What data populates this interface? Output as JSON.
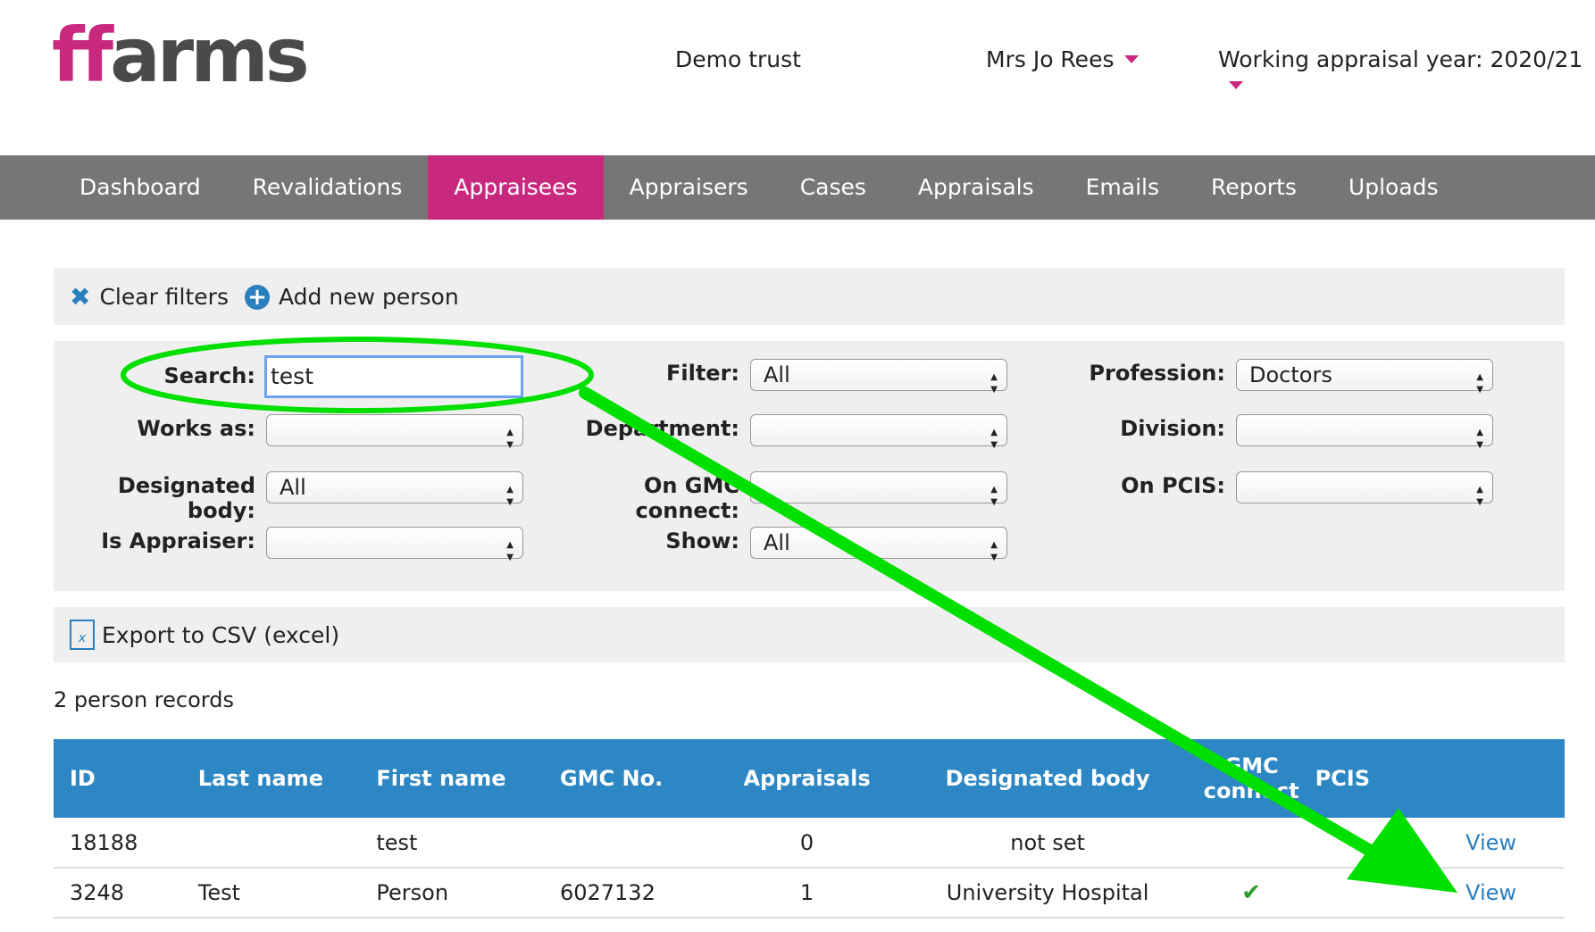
{
  "header": {
    "logo_ff": "ff",
    "logo_rest": "arms",
    "organisation": "Demo trust",
    "user": "Mrs Jo Rees",
    "appraisal_year": "Working appraisal year: 2020/21"
  },
  "nav": {
    "items": [
      "Dashboard",
      "Revalidations",
      "Appraisees",
      "Appraisers",
      "Cases",
      "Appraisals",
      "Emails",
      "Reports",
      "Uploads"
    ],
    "active": "Appraisees"
  },
  "actions": {
    "clear_filters": "Clear filters",
    "add_person": "Add new person",
    "export": "Export to CSV (excel)"
  },
  "filters": {
    "search_label": "Search:",
    "search_value": "test",
    "filter_label": "Filter:",
    "filter_value": "All",
    "profession_label": "Profession:",
    "profession_value": "Doctors",
    "works_as_label": "Works as:",
    "works_as_value": "",
    "department_label": "Department:",
    "department_value": "",
    "division_label": "Division:",
    "division_value": "",
    "designated_body_label": "Designated body:",
    "designated_body_value": "All",
    "gmc_connect_label": "On GMC connect:",
    "gmc_connect_value": "",
    "pcis_label": "On PCIS:",
    "pcis_value": "",
    "is_appraiser_label": "Is Appraiser:",
    "is_appraiser_value": "",
    "show_label": "Show:",
    "show_value": "All"
  },
  "records_count": "2 person records",
  "table": {
    "headers": [
      "ID",
      "Last name",
      "First name",
      "GMC No.",
      "Appraisals",
      "Designated body",
      "GMC connect",
      "PCIS"
    ],
    "rows": [
      {
        "id": "18188",
        "last": "",
        "first": "test",
        "gmc": "",
        "appraisals": "0",
        "body": "not set",
        "gmc_connect": "",
        "action": "View"
      },
      {
        "id": "3248",
        "last": "Test",
        "first": "Person",
        "gmc": "6027132",
        "appraisals": "1",
        "body": "University Hospital",
        "gmc_connect": "✔",
        "action": "View"
      }
    ]
  },
  "colors": {
    "brand": "#c8287e",
    "nav_bg": "#767676",
    "table_header": "#2c87c4",
    "link": "#2a7fc0",
    "annotation": "#00e000"
  }
}
